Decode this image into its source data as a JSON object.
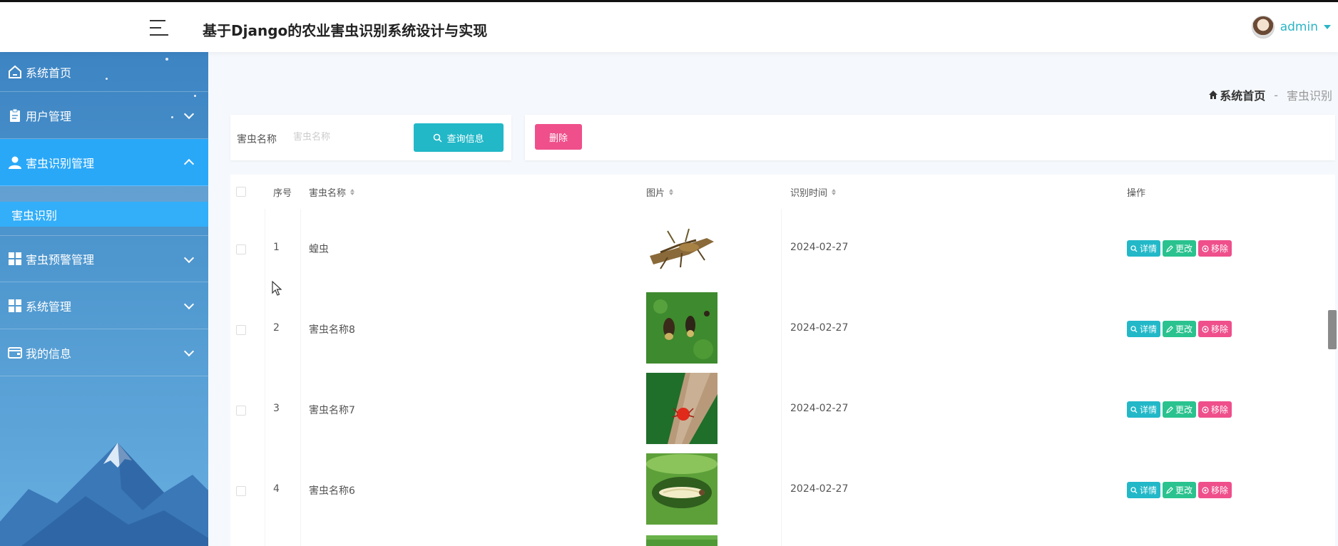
{
  "header": {
    "title": "基于Django的农业害虫识别系统设计与实现",
    "user": "admin"
  },
  "sidebar": {
    "items": [
      {
        "label": "系统首页",
        "icon": "home-icon"
      },
      {
        "label": "用户管理",
        "icon": "clipboard-icon"
      },
      {
        "label": "害虫识别管理",
        "icon": "user-icon",
        "expanded": true
      },
      {
        "label": "害虫预警管理",
        "icon": "grid-icon"
      },
      {
        "label": "系统管理",
        "icon": "grid-icon"
      },
      {
        "label": "我的信息",
        "icon": "wallet-icon"
      }
    ],
    "subitem": "害虫识别"
  },
  "breadcrumb": {
    "home": "系统首页",
    "separator": "-",
    "current": "害虫识别"
  },
  "search": {
    "label": "害虫名称",
    "placeholder": "害虫名称",
    "button": "查询信息"
  },
  "actions": {
    "delete": "删除"
  },
  "table": {
    "headers": {
      "index": "序号",
      "name": "害虫名称",
      "image": "图片",
      "time": "识别时间",
      "ops": "操作"
    },
    "rows": [
      {
        "index": "1",
        "name": "蝗虫",
        "time": "2024-02-27"
      },
      {
        "index": "2",
        "name": "害虫名称8",
        "time": "2024-02-27"
      },
      {
        "index": "3",
        "name": "害虫名称7",
        "time": "2024-02-27"
      },
      {
        "index": "4",
        "name": "害虫名称6",
        "time": "2024-02-27"
      }
    ],
    "op_labels": {
      "detail": "详情",
      "edit": "更改",
      "remove": "移除"
    }
  },
  "colors": {
    "accent": "#22b8c8",
    "danger": "#ef4f8b",
    "success": "#2ac28f",
    "sidebar_active": "#2aa8f8"
  }
}
